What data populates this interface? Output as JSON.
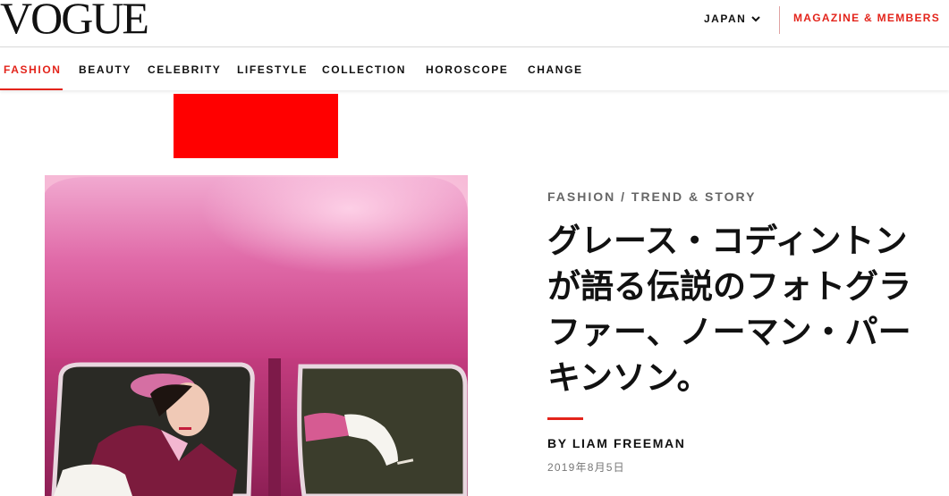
{
  "header": {
    "logo": "VOGUE",
    "region": "JAPAN",
    "members_link": "MAGAZINE & MEMBERS"
  },
  "nav": {
    "items": [
      {
        "label": "FASHION",
        "active": true
      },
      {
        "label": "BEAUTY",
        "active": false
      },
      {
        "label": "CELEBRITY",
        "active": false
      },
      {
        "label": "LIFESTYLE",
        "active": false
      },
      {
        "label": "COLLECTION",
        "active": false
      },
      {
        "label": "HOROSCOPE",
        "active": false
      },
      {
        "label": "CHANGE",
        "active": false
      }
    ]
  },
  "article": {
    "kicker": "FASHION / TREND & STORY",
    "headline": "グレース・コディントンが語る伝説のフォトグラファー、ノーマン・パーキンソン。",
    "byline": "BY LIAM FREEMAN",
    "date": "2019年8月5日"
  },
  "colors": {
    "accent": "#e3241b",
    "ad_block": "#ff0000",
    "car_pink": "#d64f93"
  }
}
